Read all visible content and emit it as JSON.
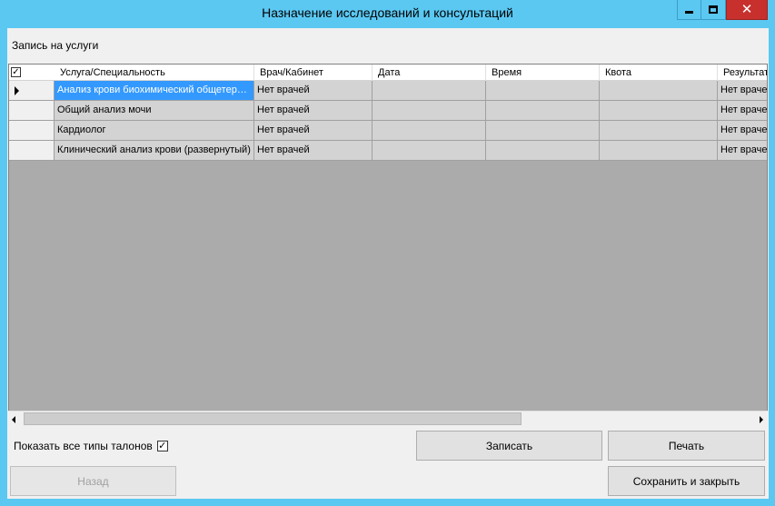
{
  "window": {
    "title": "Назначение исследований и консультаций",
    "close_glyph": "✕"
  },
  "section": {
    "label": "Запись на услуги"
  },
  "grid": {
    "header_check": "✓",
    "columns": [
      "Услуга/Специальность",
      "Врач/Кабинет",
      "Дата",
      "Время",
      "Квота",
      "Результат"
    ],
    "rows": [
      {
        "service": "Анализ крови биохимический общетерапевтический",
        "doctor": "Нет врачей",
        "date": "",
        "time": "",
        "quota": "",
        "result": "Нет врачей"
      },
      {
        "service": "Общий анализ мочи",
        "doctor": "Нет врачей",
        "date": "",
        "time": "",
        "quota": "",
        "result": "Нет врачей"
      },
      {
        "service": "Кардиолог",
        "doctor": "Нет врачей",
        "date": "",
        "time": "",
        "quota": "",
        "result": "Нет врачей"
      },
      {
        "service": "Клинический анализ крови (развернутый)",
        "doctor": "Нет врачей",
        "date": "",
        "time": "",
        "quota": "",
        "result": "Нет врачей"
      }
    ]
  },
  "footer": {
    "show_all_label": "Показать все типы талонов",
    "show_all_check": "✓",
    "save_label": "Записать",
    "print_label": "Печать",
    "back_label": "Назад",
    "save_close_label": "Сохранить и закрыть"
  },
  "colors": {
    "title_bar": "#5bc8f2",
    "close_button": "#c7302d",
    "selection": "#3399ff",
    "grid_background": "#ababab"
  }
}
